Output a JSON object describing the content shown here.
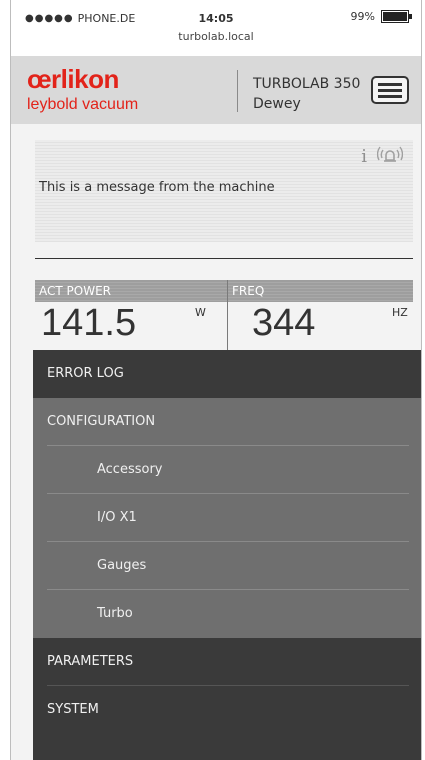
{
  "status_bar": {
    "carrier": "PHONE.DE",
    "signal_dots": "●●●●●",
    "time": "14:05",
    "url": "turbolab.local",
    "battery": "99%"
  },
  "header": {
    "brand_name": "œrlikon",
    "brand_sub": "leybold vacuum",
    "device_model": "TURBOLAB 350",
    "device_name": "Dewey"
  },
  "message": {
    "text": "This is a message from the machine",
    "info_glyph": "i"
  },
  "metrics": [
    {
      "label": "ACT POWER",
      "value": "141.5",
      "unit": "W"
    },
    {
      "label": "FREQ",
      "value": "344",
      "unit": "HZ"
    }
  ],
  "menu": {
    "error_log": "ERROR LOG",
    "configuration": "CONFIGURATION",
    "configuration_items": [
      "Accessory",
      "I/O X1",
      "Gauges",
      "Turbo"
    ],
    "parameters": "PARAMETERS",
    "system": "SYSTEM"
  },
  "colors": {
    "brand_red": "#e2231a",
    "menu_dark": "#3a3a3a",
    "menu_group": "#6f6f6f"
  }
}
